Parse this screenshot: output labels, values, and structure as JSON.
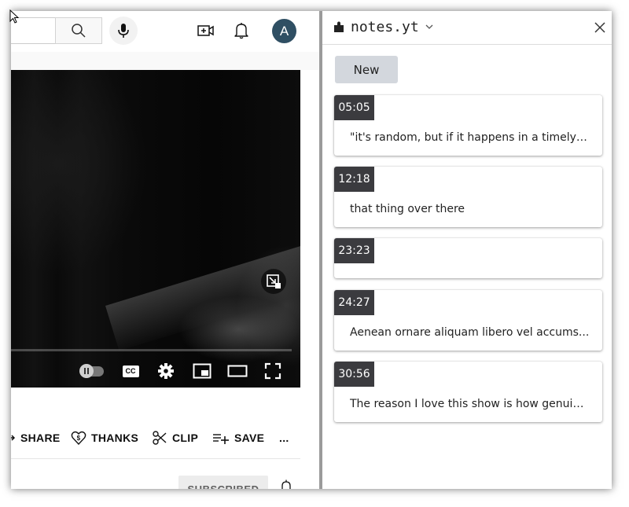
{
  "youtube": {
    "avatar_letter": "A",
    "actions": {
      "share": "SHARE",
      "thanks": "THANKS",
      "clip": "CLIP",
      "save": "SAVE",
      "more": "..."
    },
    "subscribed_label": "SUBSCRIBED",
    "controls": {
      "cc_label": "CC",
      "autoplay_on": false
    },
    "icons": [
      "search-icon",
      "mic-icon",
      "create-video-icon",
      "bell-icon",
      "miniplayer-icon",
      "autoplay-toggle",
      "cc-icon",
      "settings-icon",
      "miniplayer-icon",
      "theater-mode-icon",
      "fullscreen-icon",
      "share-icon",
      "thanks-icon",
      "clip-icon",
      "save-icon",
      "more-icon"
    ]
  },
  "notes_panel": {
    "title": "notes.yt",
    "new_button": "New",
    "notes": [
      {
        "timestamp": "05:05",
        "text": "\"it's random, but if it happens in a timely ..."
      },
      {
        "timestamp": "12:18",
        "text": "that thing over there"
      },
      {
        "timestamp": "23:23",
        "text": ""
      },
      {
        "timestamp": "24:27",
        "text": "Aenean ornare aliquam libero vel accums..."
      },
      {
        "timestamp": "30:56",
        "text": "The reason I love this show is how genuin..."
      }
    ]
  },
  "colors": {
    "timestamp_bg": "#3b3b3f",
    "new_button_bg": "#d3d7dd",
    "avatar_bg": "#2f4f63"
  }
}
